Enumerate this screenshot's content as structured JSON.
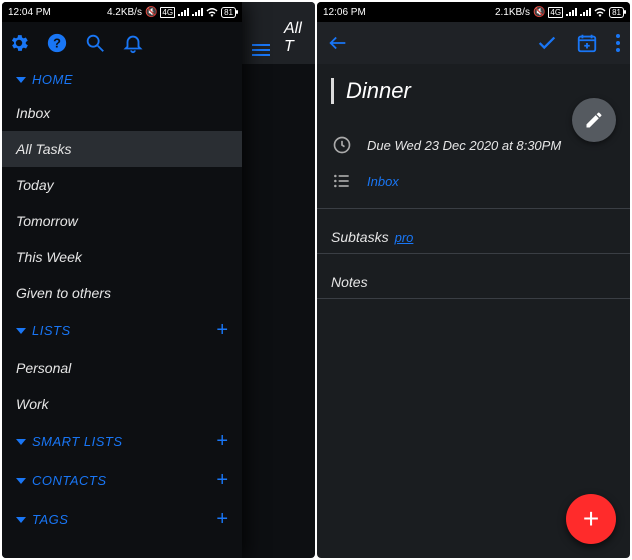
{
  "left": {
    "status": {
      "time": "12:04 PM",
      "speed": "4.2KB/s",
      "battery": "81"
    },
    "under_title": "All T",
    "home_label": "HOME",
    "nav": [
      "Inbox",
      "All Tasks",
      "Today",
      "Tomorrow",
      "This Week",
      "Given to others"
    ],
    "lists_label": "LISTS",
    "lists": [
      "Personal",
      "Work"
    ],
    "smart_label": "SMART LISTS",
    "contacts_label": "CONTACTS",
    "tags_label": "TAGS"
  },
  "right": {
    "status": {
      "time": "12:06 PM",
      "speed": "2.1KB/s",
      "battery": "81"
    },
    "task_title": "Dinner",
    "due_text": "Due Wed 23 Dec 2020 at 8:30PM",
    "list_name": "Inbox",
    "subtasks_label": "Subtasks",
    "pro_label": "pro",
    "notes_label": "Notes"
  }
}
